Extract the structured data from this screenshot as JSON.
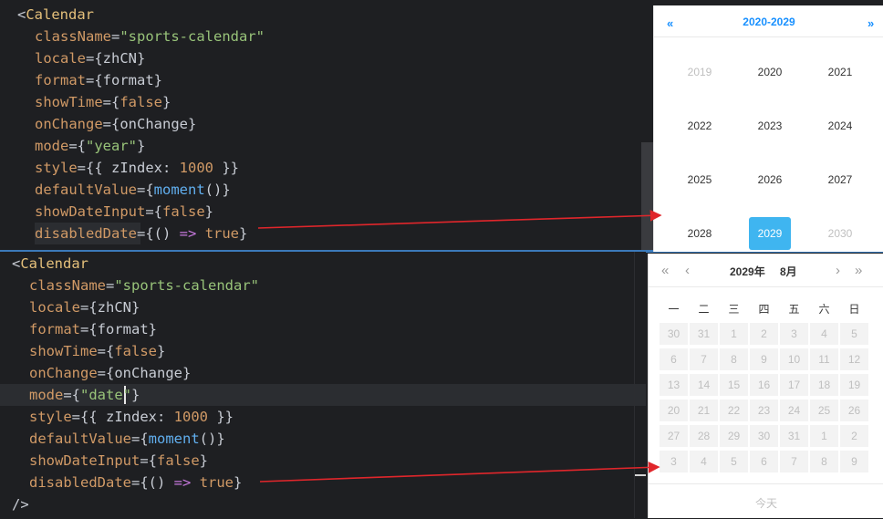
{
  "top_editor": {
    "lines": [
      [
        "<",
        "Calendar",
        "",
        "",
        ""
      ],
      [
        "",
        "className",
        "=",
        "\"sports-calendar\"",
        ""
      ],
      [
        "",
        "locale",
        "={",
        "zhCN",
        "}"
      ],
      [
        "",
        "format",
        "={",
        "format",
        "}"
      ],
      [
        "",
        "showTime",
        "={",
        "false",
        "}"
      ],
      [
        "",
        "onChange",
        "={",
        "onChange",
        "}"
      ],
      [
        "",
        "mode",
        "={",
        "\"year\"",
        "}"
      ],
      [
        "",
        "style",
        "={{ ",
        "zIndex",
        ": "
      ],
      [
        "",
        "defaultValue",
        "={",
        "moment",
        "()}"
      ],
      [
        "",
        "showDateInput",
        "={",
        "false",
        "}"
      ],
      [
        "",
        "disabledDate",
        "={",
        "() => true",
        "}"
      ]
    ],
    "style_num": "1000",
    "style_close": " }}"
  },
  "bottom_editor": {
    "lines": [
      [
        "<",
        "Calendar",
        "",
        "",
        ""
      ],
      [
        "",
        "className",
        "=",
        "\"sports-calendar\"",
        ""
      ],
      [
        "",
        "locale",
        "={",
        "zhCN",
        "}"
      ],
      [
        "",
        "format",
        "={",
        "format",
        "}"
      ],
      [
        "",
        "showTime",
        "={",
        "false",
        "}"
      ],
      [
        "",
        "onChange",
        "={",
        "onChange",
        "}"
      ],
      [
        "",
        "mode",
        "={",
        "\"date\"",
        "}"
      ],
      [
        "",
        "style",
        "={{ ",
        "zIndex",
        ": "
      ],
      [
        "",
        "defaultValue",
        "={",
        "moment",
        "()}"
      ],
      [
        "",
        "showDateInput",
        "={",
        "false",
        "}"
      ],
      [
        "",
        "disabledDate",
        "={",
        "() => true",
        "}"
      ],
      [
        "/>",
        "",
        "",
        "",
        ""
      ]
    ],
    "style_num": "1000",
    "style_close": " }}"
  },
  "year_calendar": {
    "prev": "«",
    "next": "»",
    "decade": "2020-2029",
    "years": [
      "2019",
      "2020",
      "2021",
      "2022",
      "2023",
      "2024",
      "2025",
      "2026",
      "2027",
      "2028",
      "2029",
      "2030"
    ],
    "muted": [
      "2019",
      "2030"
    ],
    "selected": "2029"
  },
  "date_calendar": {
    "prev_year": "«",
    "prev_month": "‹",
    "next_month": "›",
    "next_year": "»",
    "year_label": "2029年",
    "month_label": "8月",
    "weekdays": [
      "一",
      "二",
      "三",
      "四",
      "五",
      "六",
      "日"
    ],
    "days": [
      [
        "30",
        "31",
        "1",
        "2",
        "3",
        "4",
        "5"
      ],
      [
        "6",
        "7",
        "8",
        "9",
        "10",
        "11",
        "12"
      ],
      [
        "13",
        "14",
        "15",
        "16",
        "17",
        "18",
        "19"
      ],
      [
        "20",
        "21",
        "22",
        "23",
        "24",
        "25",
        "26"
      ],
      [
        "27",
        "28",
        "29",
        "30",
        "31",
        "1",
        "2"
      ],
      [
        "3",
        "4",
        "5",
        "6",
        "7",
        "8",
        "9"
      ]
    ],
    "today": "今天"
  },
  "colors": {
    "arrow": "#e0262b",
    "selected": "#3fb5f0",
    "accent": "#1890ff"
  }
}
